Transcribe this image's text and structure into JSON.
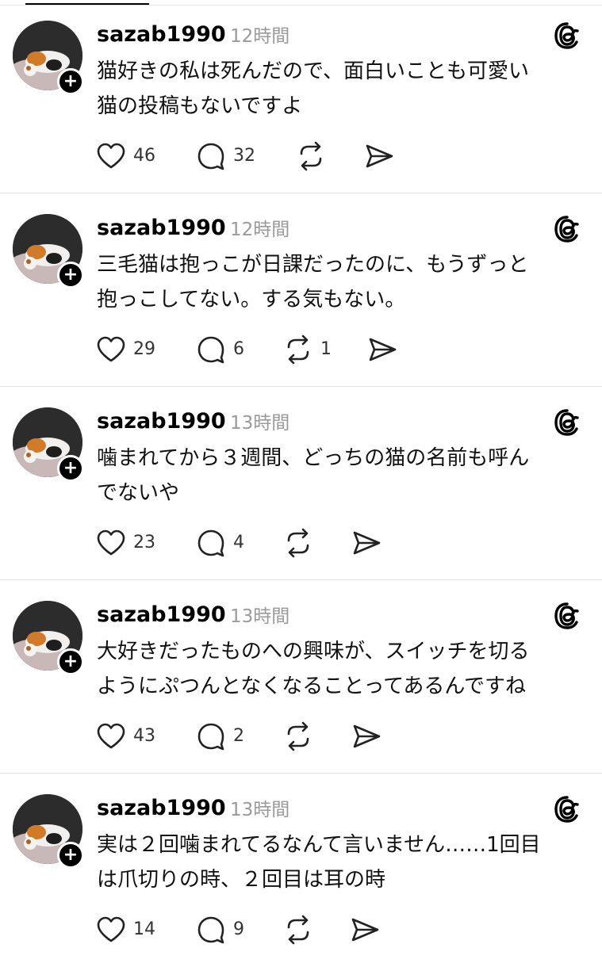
{
  "posts": [
    {
      "username": "sazab1990",
      "time": "12時間",
      "lines": [
        "猫好きの私は死んだので、面白いことも可愛い",
        "猫の投稿もないですよ"
      ],
      "likes": "46",
      "replies": "32",
      "reposts": "",
      "follow_label": "+"
    },
    {
      "username": "sazab1990",
      "time": "12時間",
      "lines": [
        "三毛猫は抱っこが日課だったのに、もうずっと",
        "抱っこしてない。する気もない。"
      ],
      "likes": "29",
      "replies": "6",
      "reposts": "1",
      "follow_label": "+"
    },
    {
      "username": "sazab1990",
      "time": "13時間",
      "lines": [
        "噛まれてから３週間、どっちの猫の名前も呼ん",
        "でないや"
      ],
      "likes": "23",
      "replies": "4",
      "reposts": "",
      "follow_label": "+"
    },
    {
      "username": "sazab1990",
      "time": "13時間",
      "lines": [
        "大好きだったものへの興味が、スイッチを切る",
        "ようにぷつんとなくなることってあるんですね"
      ],
      "likes": "43",
      "replies": "2",
      "reposts": "",
      "follow_label": "+"
    },
    {
      "username": "sazab1990",
      "time": "13時間",
      "lines": [
        "実は２回噛まれてるなんて言いません……1回目",
        "は爪切りの時、２回目は耳の時"
      ],
      "likes": "14",
      "replies": "9",
      "reposts": "",
      "follow_label": "+"
    }
  ],
  "icons": {
    "like": "heart-icon",
    "reply": "comment-icon",
    "repost": "repost-icon",
    "share": "share-icon",
    "app": "threads-logo-icon"
  },
  "colors": {
    "text": "#000000",
    "secondary": "#9a9a9a",
    "divider": "#e0e0e0",
    "badge": "#000000"
  }
}
